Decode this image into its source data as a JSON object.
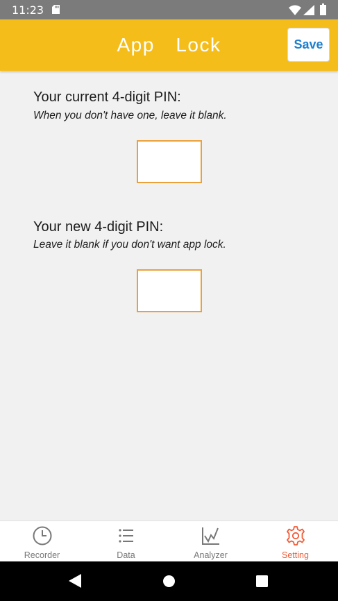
{
  "status_bar": {
    "time": "11:23"
  },
  "app_bar": {
    "title": "App  Lock",
    "save_label": "Save"
  },
  "current_pin": {
    "title": "Your current 4-digit PIN:",
    "hint": "When you don't have one, leave it blank.",
    "value": ""
  },
  "new_pin": {
    "title": "Your new 4-digit PIN:",
    "hint": "Leave it blank if you don't want app lock.",
    "value": ""
  },
  "bottom_nav": {
    "items": [
      {
        "label": "Recorder",
        "icon": "clock-icon"
      },
      {
        "label": "Data",
        "icon": "list-icon"
      },
      {
        "label": "Analyzer",
        "icon": "chart-icon"
      },
      {
        "label": "Setting",
        "icon": "gear-icon",
        "active": true
      }
    ]
  },
  "colors": {
    "app_bar": "#f5bd1a",
    "input_border": "#eba13a",
    "save_text": "#1b7fcf",
    "active_tab": "#f25a34",
    "inactive_tab": "#777777"
  }
}
